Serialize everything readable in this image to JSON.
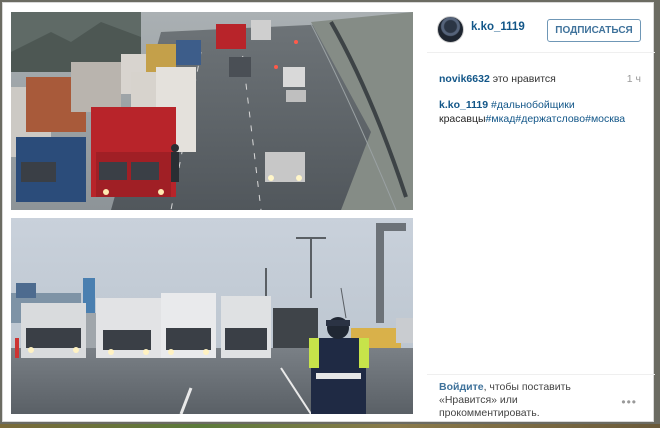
{
  "post": {
    "username": "k.ko_1119",
    "follow_label": "ПОДПИСАТЬСЯ",
    "liker": "novik6632",
    "likes_text": "это нравится",
    "time_ago": "1 ч",
    "caption_author": "k.ko_1119",
    "caption_tag_1": "#дальнобойщики",
    "caption_text": "красавцы",
    "caption_tag_2": "#мкад",
    "caption_tag_3": "#держатсловo",
    "caption_tag_4": "#москва"
  },
  "footer": {
    "login_link": "Войдите",
    "login_text": ", чтобы поставить «Нравится» или прокомментировать.",
    "more_icon": "•••"
  },
  "images": {
    "top": "traffic-jam-highway",
    "bottom": "trucks-blocking-road-police-officer"
  },
  "colors": {
    "link": "#125688",
    "button_text": "#3f729b",
    "truck_red": "#b8242a",
    "truck_blue": "#2b4c7a"
  }
}
